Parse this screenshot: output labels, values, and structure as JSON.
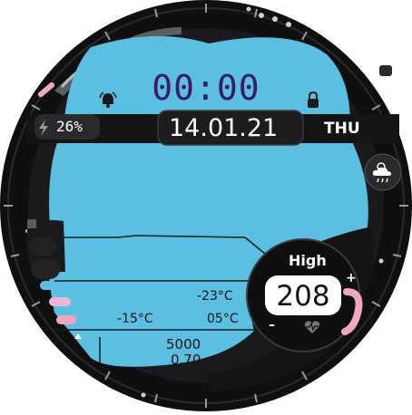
{
  "time": "00:00",
  "date": "14.01.21",
  "day": "THU",
  "battery": {
    "label": "26%",
    "level_percent": 26
  },
  "heart_rate": {
    "label": "High",
    "value": "208",
    "plus": "+",
    "minus": "–"
  },
  "weather": {
    "temperature_1": "-23°C",
    "temperature_2": "-15°C",
    "temperature_3": "05°C",
    "icon": "cloud-rain-icon"
  },
  "steps": "5000",
  "distance": "0.70",
  "icons": {
    "alarm": "alarm-bell-icon",
    "lock": "lock-icon",
    "battery": "lightning-bolt-icon",
    "heart": "heart-pulse-icon"
  },
  "colors": {
    "bezel": "#141414",
    "screen": "#5bbfe2",
    "time_text": "#3a1a6b",
    "accent_pink": "#f0a6c0",
    "accent_blue": "#5bbfe2",
    "accent_lilac": "#e6b8d6"
  }
}
